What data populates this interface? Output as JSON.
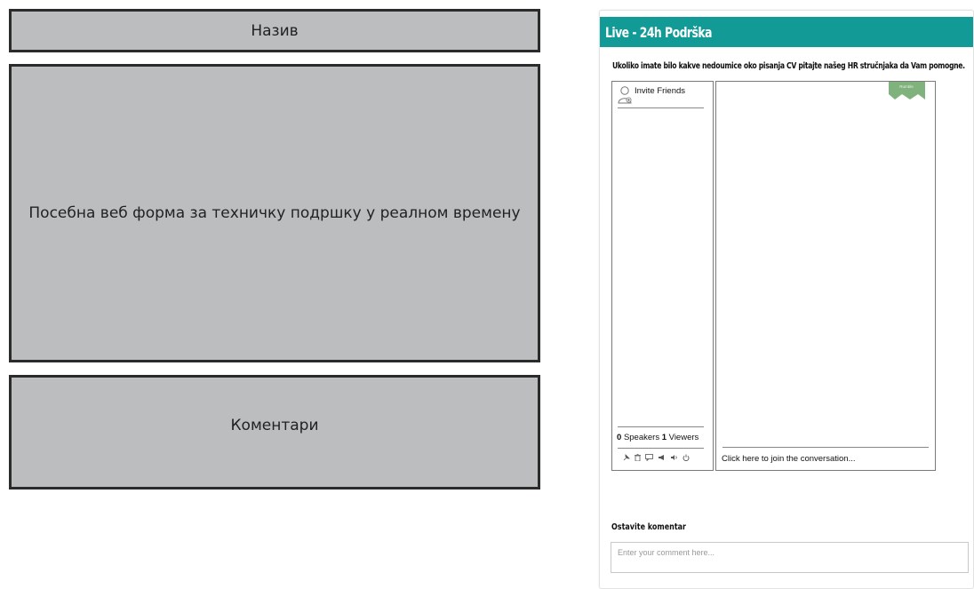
{
  "wireframe": {
    "title_label": "Назив",
    "form_label": "Посебна веб форма за техничку подршку у реалном времену",
    "comments_label": "Коментари"
  },
  "panel": {
    "header_title": "Live - 24h Podrška",
    "intro_text": "Ukoliko imate bilo kakve nedoumice oko pisanja CV pitajte našeg HR stručnjaka da Vam pomogne.",
    "invite_label": "Invite Friends",
    "speakers_count": "0",
    "speakers_label": "Speakers",
    "viewers_count": "1",
    "viewers_label": "Viewers",
    "ribbon_label": "Rumble",
    "join_text": "Click here to join the conversation...",
    "leave_comment_label": "Ostavite komentar",
    "comment_placeholder": "Enter your comment here..."
  },
  "icons": {
    "tools": [
      "pin-icon",
      "trash-icon",
      "chat-icon",
      "megaphone-icon",
      "volume-icon",
      "power-icon"
    ]
  },
  "colors": {
    "header_bg": "#129b96",
    "wire_fill": "#bcbdbf",
    "ribbon_green": "#7fb27c"
  }
}
